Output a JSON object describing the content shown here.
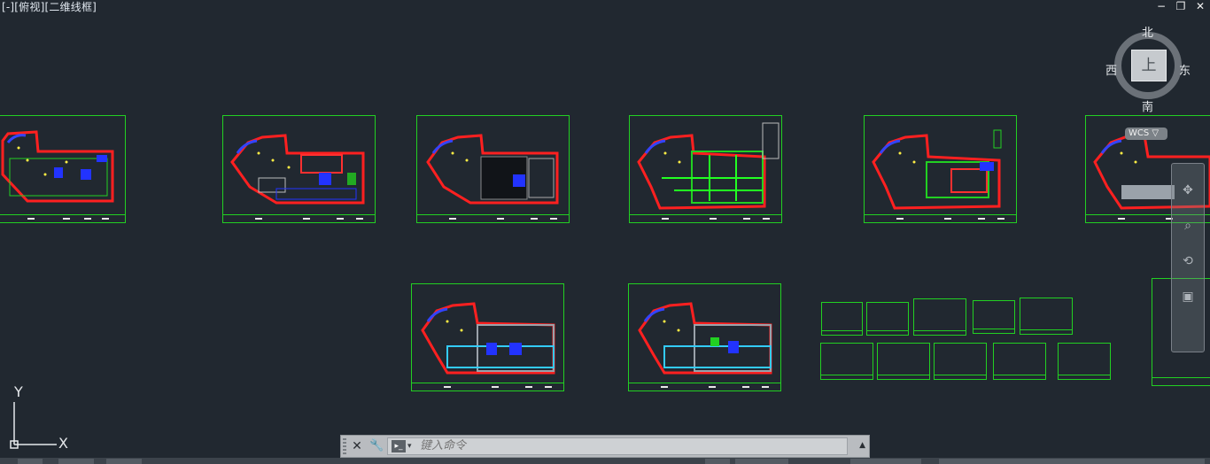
{
  "viewport": {
    "label": "[-][俯视][二维线框]"
  },
  "window_controls": {
    "minimize": "−",
    "restore": "❐",
    "close": "✕"
  },
  "viewcube": {
    "north": "北",
    "south": "南",
    "east": "东",
    "west": "西",
    "face": "上",
    "wcs": "WCS ▽"
  },
  "ucs": {
    "y_label": "Y",
    "x_label": "X"
  },
  "command_line": {
    "placeholder": "键入命令",
    "close_glyph": "✕",
    "tool_glyph": "🔧",
    "prompt_glyph": "▸_",
    "prompt_caret": "▾",
    "scroll_glyph": "▲"
  },
  "navbar": {
    "icons": [
      "navbar-pan-icon",
      "navbar-zoom-icon",
      "navbar-orbit-icon",
      "navbar-showmotion-icon"
    ]
  }
}
